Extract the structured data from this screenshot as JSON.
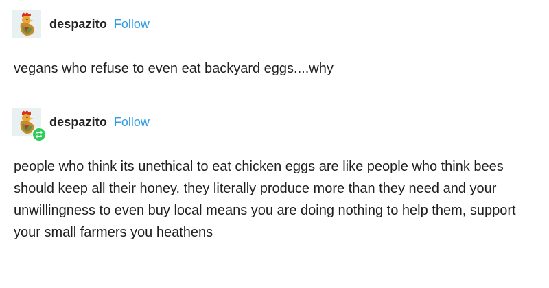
{
  "posts": [
    {
      "avatar_icon": "rooster-avatar-icon",
      "username": "despazito",
      "follow_label": "Follow",
      "text": "vegans who refuse to even eat backyard eggs....why"
    },
    {
      "avatar_icon": "rooster-avatar-icon",
      "reblog_icon": "reblog-icon",
      "username": "despazito",
      "follow_label": "Follow",
      "text": "people who think its unethical to eat chicken eggs are like people who think bees should keep all their honey. they literally produce more than they need and your unwillingness to even buy local means you are doing nothing to help them, support your small farmers you heathens"
    }
  ],
  "colors": {
    "follow": "#2f9ce6",
    "reblog_badge": "#2ecc5a",
    "divider": "#d9d9d9"
  }
}
